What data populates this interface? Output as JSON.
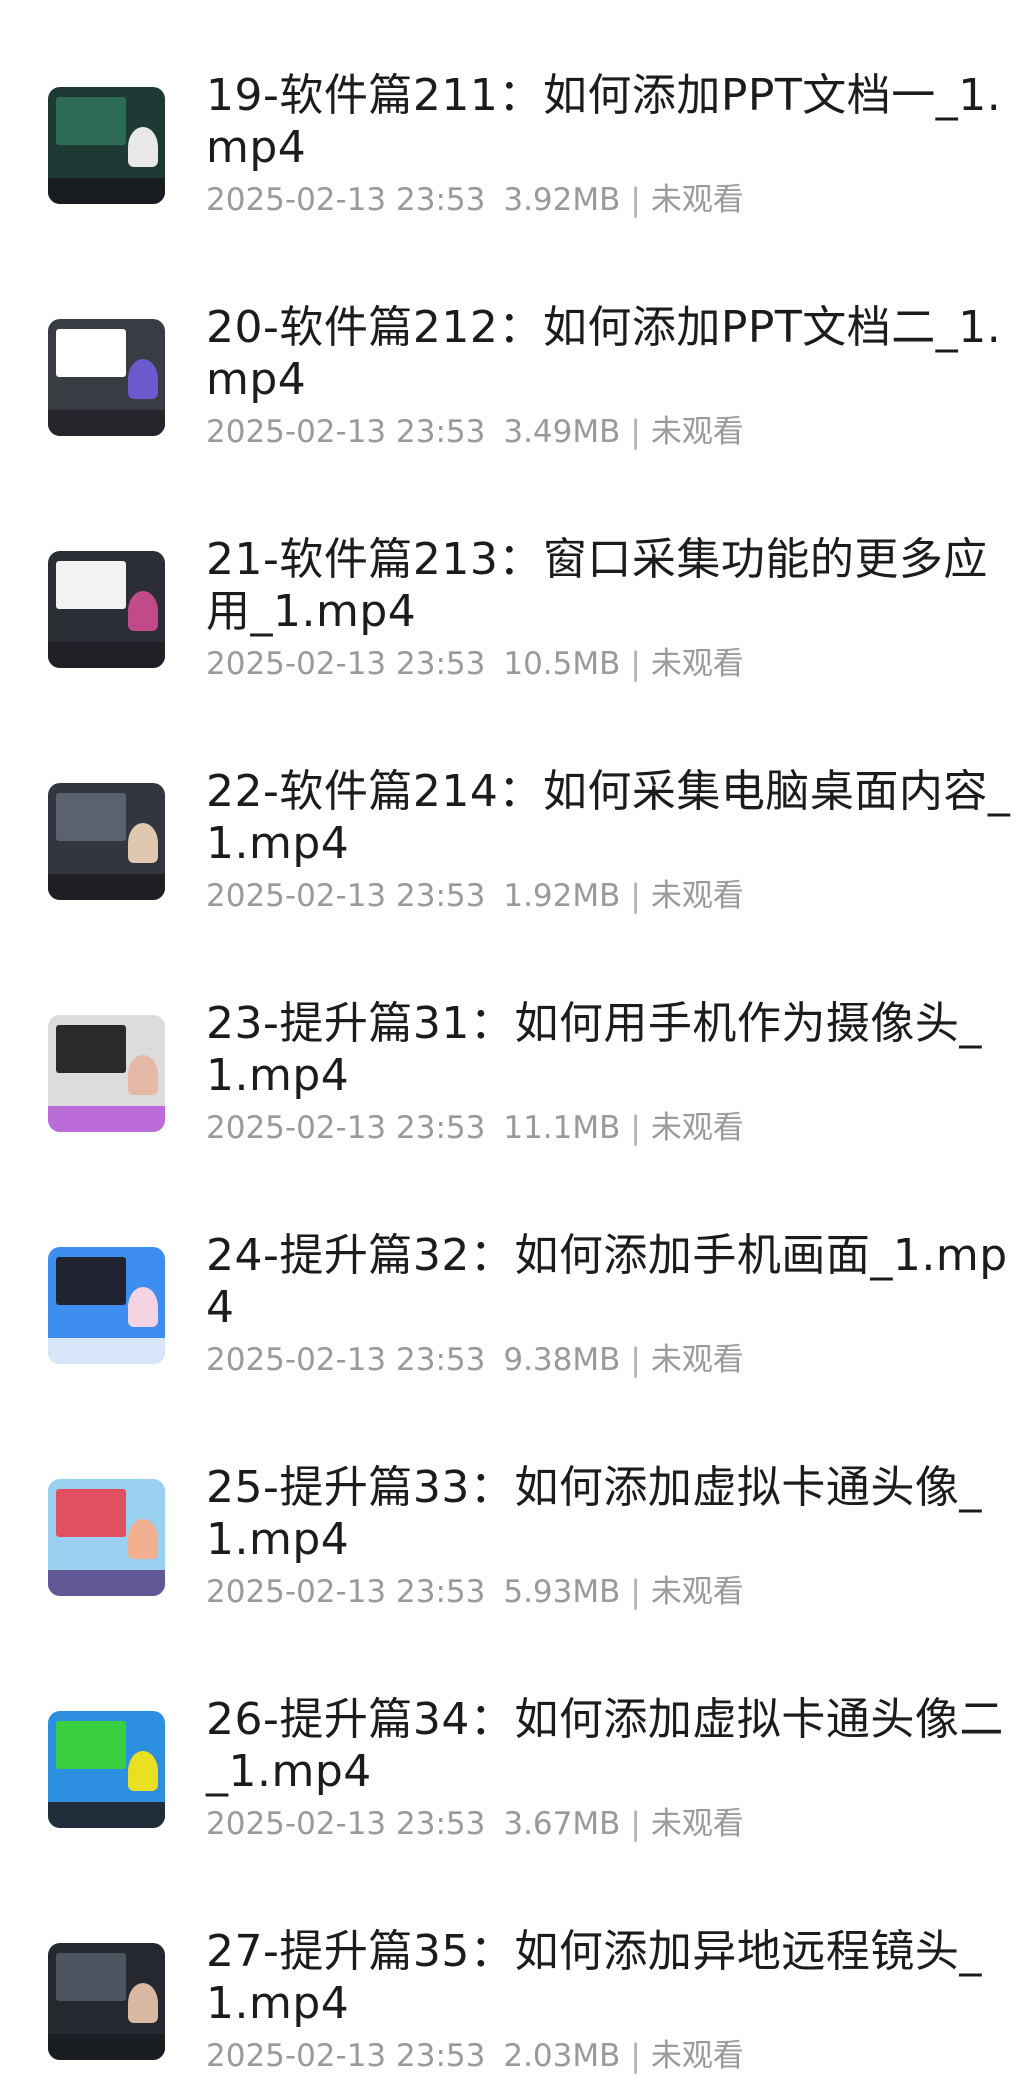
{
  "files": [
    {
      "title": "19-软件篇211：如何添加PPT文档一_1.mp4",
      "date": "2025-02-13 23:53",
      "size": "3.92MB",
      "status": "未观看",
      "thumb_colors": [
        "#1f3a34",
        "#2d6b55",
        "#e8e8e8",
        "#181a1f"
      ]
    },
    {
      "title": "20-软件篇212：如何添加PPT文档二_1.mp4",
      "date": "2025-02-13 23:53",
      "size": "3.49MB",
      "status": "未观看",
      "thumb_colors": [
        "#3a3c44",
        "#ffffff",
        "#6a5acd",
        "#22242a"
      ]
    },
    {
      "title": "21-软件篇213：窗口采集功能的更多应用_1.mp4",
      "date": "2025-02-13 23:53",
      "size": "10.5MB",
      "status": "未观看",
      "thumb_colors": [
        "#2b2e35",
        "#f2f2f2",
        "#c04a8a",
        "#1e2026"
      ]
    },
    {
      "title": "22-软件篇214：如何采集电脑桌面内容_1.mp4",
      "date": "2025-02-13 23:53",
      "size": "1.92MB",
      "status": "未观看",
      "thumb_colors": [
        "#33363e",
        "#5a6270",
        "#e0c8b0",
        "#1b1d22"
      ]
    },
    {
      "title": "23-提升篇31：如何用手机作为摄像头_1.mp4",
      "date": "2025-02-13 23:53",
      "size": "11.1MB",
      "status": "未观看",
      "thumb_colors": [
        "#dcdcdc",
        "#2a2a2a",
        "#e6b8a6",
        "#b85fd8"
      ]
    },
    {
      "title": "24-提升篇32：如何添加手机画面_1.mp4",
      "date": "2025-02-13 23:53",
      "size": "9.38MB",
      "status": "未观看",
      "thumb_colors": [
        "#3d8ef0",
        "#1f2430",
        "#f4d4e2",
        "#e7eef8"
      ]
    },
    {
      "title": "25-提升篇33：如何添加虚拟卡通头像_1.mp4",
      "date": "2025-02-13 23:53",
      "size": "5.93MB",
      "status": "未观看",
      "thumb_colors": [
        "#9ad0f0",
        "#e05060",
        "#f0b090",
        "#5a4a8a"
      ]
    },
    {
      "title": "26-提升篇34：如何添加虚拟卡通头像二_1.mp4",
      "date": "2025-02-13 23:53",
      "size": "3.67MB",
      "status": "未观看",
      "thumb_colors": [
        "#2c8fe0",
        "#38d040",
        "#e8e020",
        "#202228"
      ]
    },
    {
      "title": "27-提升篇35：如何添加异地远程镜头_1.mp4",
      "date": "2025-02-13 23:53",
      "size": "2.03MB",
      "status": "未观看",
      "thumb_colors": [
        "#25282e",
        "#4e5560",
        "#d8b8a0",
        "#1a1c20"
      ]
    }
  ],
  "separator": "|"
}
